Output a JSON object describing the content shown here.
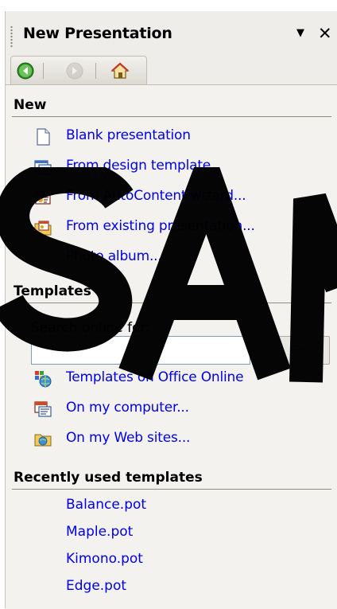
{
  "pane": {
    "title": "New Presentation",
    "dropdown_glyph": "▼",
    "close_glyph": "✕"
  },
  "nav": {
    "back_icon": "back-arrow-icon",
    "forward_icon": "forward-arrow-icon",
    "home_icon": "home-icon"
  },
  "sections": {
    "new": {
      "header": "New",
      "items": [
        {
          "label": "Blank presentation",
          "icon": "blank-document-icon"
        },
        {
          "label": "From design template",
          "icon": "design-template-icon"
        },
        {
          "label": "From AutoContent wizard...",
          "icon": "autocontent-wizard-icon"
        },
        {
          "label": "From existing presentation...",
          "icon": "existing-presentation-icon"
        },
        {
          "label": "Photo album..."
        }
      ]
    },
    "templates": {
      "header": "Templates",
      "search_label": "Search online for:",
      "search_value": "",
      "go_label": "Go",
      "items": [
        {
          "label": "Templates on Office Online",
          "icon": "office-online-icon"
        },
        {
          "label": "On my computer...",
          "icon": "computer-templates-icon"
        },
        {
          "label": "On my Web sites...",
          "icon": "web-folder-icon"
        }
      ]
    },
    "recent": {
      "header": "Recently used templates",
      "items": [
        "Balance.pot",
        "Maple.pot",
        "Kimono.pot",
        "Edge.pot"
      ]
    }
  },
  "watermark": {
    "color": "#000000"
  },
  "colors": {
    "link": "#0000ee",
    "pane_bg": "#eeedea"
  }
}
